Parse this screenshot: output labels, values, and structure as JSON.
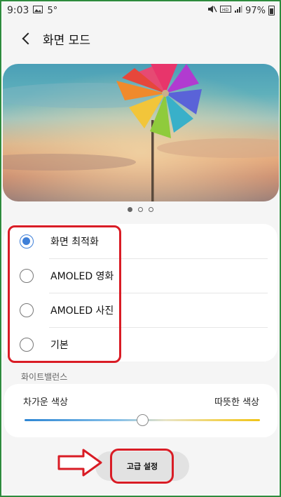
{
  "status_bar": {
    "time": "9:03",
    "temperature": "5°",
    "battery": "97%",
    "icons": [
      "image-icon",
      "mute-icon",
      "wifi-hd-icon",
      "signal-icon",
      "battery-icon"
    ]
  },
  "header": {
    "title": "화면 모드",
    "back_icon": "chevron-left-icon"
  },
  "preview": {
    "page_count": 3,
    "active_page": 1
  },
  "modes": {
    "selected": 0,
    "options": [
      {
        "label": "화면 최적화"
      },
      {
        "label": "AMOLED 영화"
      },
      {
        "label": "AMOLED 사진"
      },
      {
        "label": "기본"
      }
    ]
  },
  "white_balance": {
    "title": "화이트밸런스",
    "cool_label": "차가운 색상",
    "warm_label": "따뜻한 색상",
    "level": 0.5
  },
  "advanced_button": {
    "label": "고급 설정"
  },
  "colors": {
    "accent": "#3e7fd8",
    "annotation": "#d91c25",
    "frame": "#2e8b3d"
  }
}
